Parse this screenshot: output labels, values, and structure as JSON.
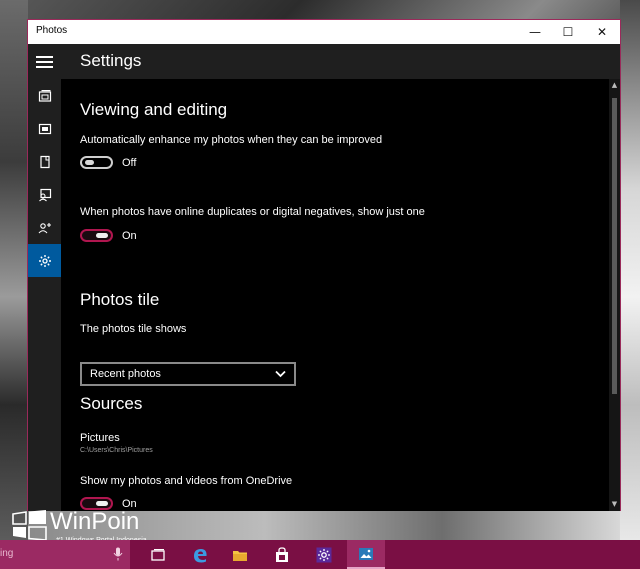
{
  "window": {
    "title": "Photos",
    "controls": {
      "minimize": "—",
      "maximize": "☐",
      "close": "✕"
    }
  },
  "header": {
    "page_title": "Settings"
  },
  "nav": {
    "items": [
      {
        "icon": "collection-icon"
      },
      {
        "icon": "albums-icon"
      },
      {
        "icon": "folders-icon"
      },
      {
        "icon": "people-icon"
      },
      {
        "icon": "share-icon"
      },
      {
        "icon": "gear-icon",
        "active": true
      }
    ]
  },
  "settings": {
    "viewing_title": "Viewing and editing",
    "auto_enhance_label": "Automatically enhance my photos when they can be improved",
    "auto_enhance_state": "Off",
    "duplicates_label": "When photos have online duplicates or digital negatives, show just one",
    "duplicates_state": "On",
    "tile_title": "Photos tile",
    "tile_label": "The photos tile shows",
    "tile_value": "Recent photos",
    "sources_title": "Sources",
    "pictures_label": "Pictures",
    "pictures_path": "C:\\Users\\Chris\\Pictures",
    "onedrive_label": "Show my photos and videos from OneDrive",
    "onedrive_state": "On"
  },
  "watermark": {
    "name": "WinPoin",
    "tagline": "#1 Windows Portal Indonesia"
  },
  "taskbar": {
    "search_text": "ing",
    "icons": [
      "task-view-icon",
      "edge-icon",
      "file-explorer-icon",
      "store-icon",
      "settings-icon",
      "photos-icon"
    ]
  },
  "colors": {
    "accent": "#005a9e",
    "toggle_on": "#b0164f",
    "taskbar": "#7a0f44",
    "window_border": "#9a2a5a"
  }
}
